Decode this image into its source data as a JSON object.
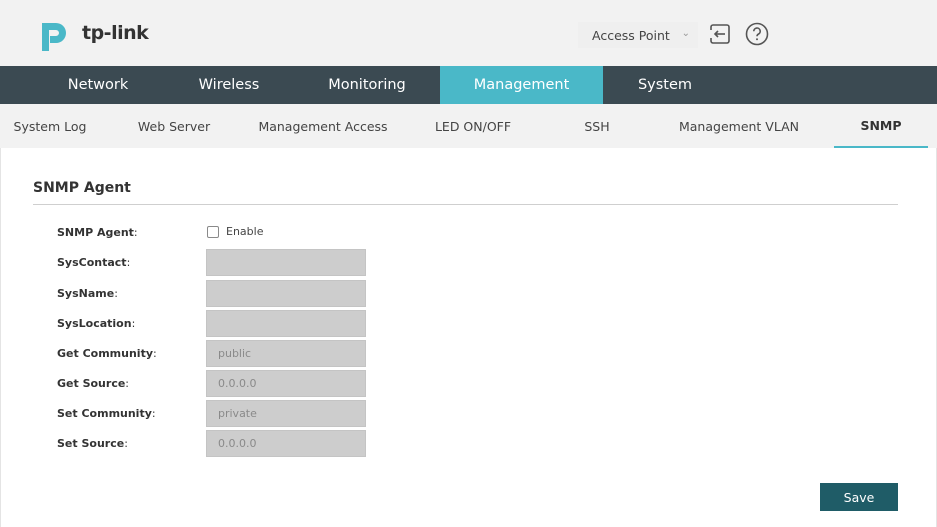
{
  "brand": {
    "name": "tp-link"
  },
  "header": {
    "mode_value": "Access Point",
    "logout_icon": "logout-icon",
    "help_icon": "help-icon"
  },
  "main_nav": {
    "tabs": [
      {
        "label": "Network"
      },
      {
        "label": "Wireless"
      },
      {
        "label": "Monitoring"
      },
      {
        "label": "Management",
        "active": true
      },
      {
        "label": "System"
      }
    ]
  },
  "sub_nav": {
    "tabs": [
      {
        "label": "System Log"
      },
      {
        "label": "Web Server"
      },
      {
        "label": "Management Access"
      },
      {
        "label": "LED ON/OFF"
      },
      {
        "label": "SSH"
      },
      {
        "label": "Management VLAN"
      },
      {
        "label": "SNMP",
        "active": true
      }
    ]
  },
  "snmp": {
    "section_title": "SNMP Agent",
    "agent_label": "SNMP Agent",
    "agent_checkbox_label": "Enable",
    "agent_enabled": false,
    "fields": [
      {
        "label": "SysContact",
        "value": ""
      },
      {
        "label": "SysName",
        "value": ""
      },
      {
        "label": "SysLocation",
        "value": ""
      },
      {
        "label": "Get Community",
        "value": "public"
      },
      {
        "label": "Get Source",
        "value": "0.0.0.0"
      },
      {
        "label": "Set Community",
        "value": "private"
      },
      {
        "label": "Set Source",
        "value": "0.0.0.0"
      }
    ],
    "save_label": "Save"
  },
  "colors": {
    "nav_bg": "#3b4a52",
    "accent": "#4ab8c8",
    "save_bg": "#1f5c67"
  }
}
